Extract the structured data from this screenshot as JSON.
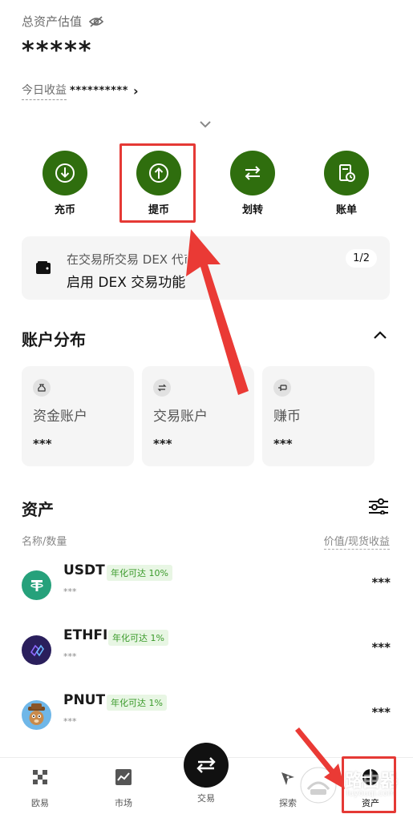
{
  "header": {
    "total_label": "总资产估值",
    "total_value": "*****",
    "today_label": "今日收益",
    "today_value": "**********",
    "today_chevron": "›"
  },
  "actions": [
    {
      "label": "充币",
      "icon": "download-icon"
    },
    {
      "label": "提币",
      "icon": "upload-icon"
    },
    {
      "label": "划转",
      "icon": "transfer-icon"
    },
    {
      "label": "账单",
      "icon": "bill-icon"
    }
  ],
  "dex_card": {
    "line1": "在交易所交易 DEX 代币",
    "line2": "启用 DEX 交易功能",
    "pager": "1/2"
  },
  "account_section": {
    "title": "账户分布",
    "cards": [
      {
        "name": "资金账户",
        "value": "***",
        "icon": "money-bag-icon"
      },
      {
        "name": "交易账户",
        "value": "***",
        "icon": "exchange-icon"
      },
      {
        "name": "赚币",
        "value": "***",
        "icon": "earn-icon"
      }
    ]
  },
  "assets_section": {
    "title": "资产",
    "col_left": "名称/数量",
    "col_right": "价值/现货收益",
    "rows": [
      {
        "symbol": "USDT",
        "badge": "年化可达 10%",
        "qty": "***",
        "value": "***",
        "logo": "usdt-logo-icon",
        "color": "#26a17b"
      },
      {
        "symbol": "ETHFI",
        "badge": "年化可达 1%",
        "qty": "***",
        "value": "***",
        "logo": "ethfi-logo-icon",
        "color": "#2a1f5c"
      },
      {
        "symbol": "PNUT",
        "badge": "年化可达 1%",
        "qty": "***",
        "value": "***",
        "logo": "pnut-logo-icon",
        "color": "#6fb7e8"
      }
    ]
  },
  "bottom_nav": {
    "items": [
      {
        "label": "欧易",
        "icon": "okx-logo-icon"
      },
      {
        "label": "市场",
        "icon": "chart-icon"
      },
      {
        "label": "交易",
        "icon": "swap-icon"
      },
      {
        "label": "探索",
        "icon": "compass-icon"
      },
      {
        "label": "资产",
        "icon": "pie-icon"
      }
    ]
  },
  "watermark": {
    "text": "路由器",
    "sub": "luyouqi.com"
  },
  "colors": {
    "accent_green": "#2f6e0e",
    "annotation_red": "#e53935",
    "badge_green": "#3a9a2a"
  }
}
